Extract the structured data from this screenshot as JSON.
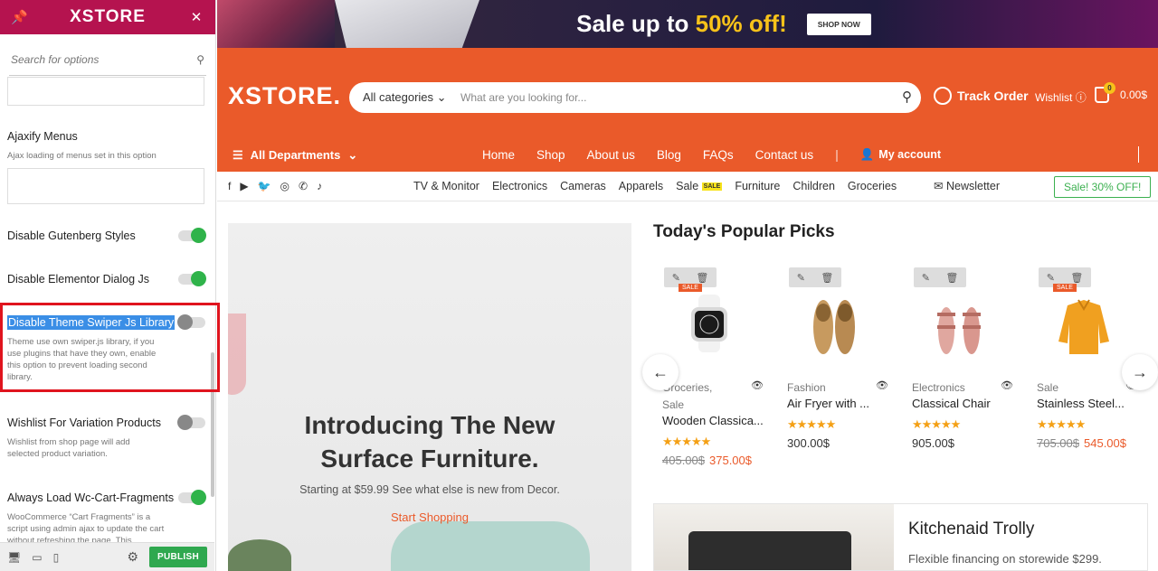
{
  "customizer": {
    "logo": "XSTORE",
    "search_placeholder": "Search for options",
    "options": [
      {
        "title": "Ajaxify Menus",
        "desc": "Ajax loading of menus set in this option"
      },
      {
        "title": "Disable Gutenberg Styles",
        "toggle": "on"
      },
      {
        "title": "Disable Elementor Dialog Js",
        "toggle": "on"
      },
      {
        "title": "Disable Theme Swiper Js Library",
        "toggle": "off",
        "desc": "Theme use own swiper.js library, if you use plugins that have they own, enable this option to prevent loading second library."
      },
      {
        "title": "Wishlist For Variation Products",
        "toggle": "off",
        "desc": "Wishlist from shop page will add selected product variation."
      },
      {
        "title": "Always Load Wc-Cart-Fragments",
        "toggle": "on",
        "desc": "WooCommerce “Cart Fragments” is a script using admin ajax to update the cart without refreshing the page. This"
      }
    ],
    "publish_label": "PUBLISH",
    "accent_color": "#b5134f"
  },
  "banner": {
    "text_before": "Sale up to ",
    "highlight": "50% off!",
    "button": "SHOP NOW"
  },
  "header": {
    "brand": "XSTORE.",
    "category_select": "All categories",
    "search_placeholder": "What are you looking for...",
    "track_order": "Track Order",
    "wishlist": "Wishlist",
    "cart_count": "0",
    "cart_total": "0.00$",
    "accent_color": "#ea5a2a"
  },
  "nav": {
    "departments": "All Departments",
    "items": [
      "Home",
      "Shop",
      "About us",
      "Blog",
      "FAQs",
      "Contact us"
    ],
    "account": "My account"
  },
  "subnav": {
    "categories": [
      "TV & Monitor",
      "Electronics",
      "Cameras",
      "Apparels",
      "Sale",
      "Furniture",
      "Children",
      "Groceries"
    ],
    "sale_badge": "SALE",
    "newsletter": "Newsletter",
    "promo_button": "Sale! 30% OFF!"
  },
  "hero": {
    "title_line1": "Introducing The New",
    "title_line2": "Surface Furniture.",
    "subtitle": "Starting at $59.99 See what else is new from Decor.",
    "cta": "Start Shopping"
  },
  "popular": {
    "title": "Today's Popular Picks",
    "products": [
      {
        "category_line1": "Groceries,",
        "category_line2": "Sale",
        "name": "Wooden Classica...",
        "stars": "★★★★★",
        "old_price": "405.00$",
        "price": "375.00$",
        "sale_badge": "SALE"
      },
      {
        "category_line1": "Fashion",
        "category_line2": "",
        "name": "Air Fryer with ...",
        "stars": "★★★★★",
        "old_price": "",
        "price": "300.00$",
        "sale_badge": ""
      },
      {
        "category_line1": "Electronics",
        "category_line2": "",
        "name": "Classical Chair",
        "stars": "★★★★★",
        "old_price": "",
        "price": "905.00$",
        "sale_badge": ""
      },
      {
        "category_line1": "Sale",
        "category_line2": "",
        "name": "Stainless Steel...",
        "stars": "★★★★★",
        "old_price": "705.00$",
        "price": "545.00$",
        "sale_badge": "SALE"
      }
    ]
  },
  "promo": {
    "title": "Kitchenaid Trolly",
    "subtitle": "Flexible financing on storewide $299."
  }
}
